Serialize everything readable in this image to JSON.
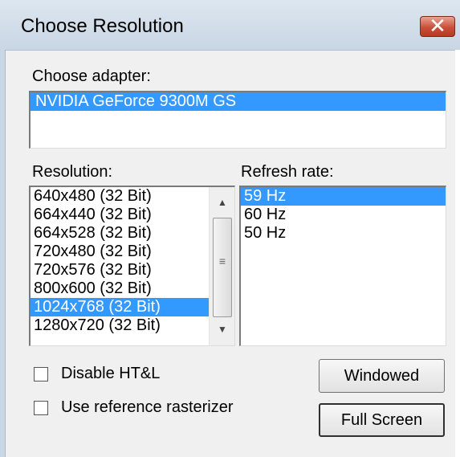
{
  "window": {
    "title": "Choose Resolution",
    "close_glyph": "✕"
  },
  "adapter": {
    "label": "Choose adapter:",
    "items": [
      {
        "label": "NVIDIA GeForce 9300M GS"
      }
    ],
    "selected": 0
  },
  "resolution": {
    "label": "Resolution:",
    "items": [
      {
        "label": "640x480 (32 Bit)"
      },
      {
        "label": "664x440 (32 Bit)"
      },
      {
        "label": "664x528 (32 Bit)"
      },
      {
        "label": "720x480 (32 Bit)"
      },
      {
        "label": "720x576 (32 Bit)"
      },
      {
        "label": "800x600 (32 Bit)"
      },
      {
        "label": "1024x768 (32 Bit)"
      },
      {
        "label": "1280x720 (32 Bit)"
      }
    ],
    "selected": 6,
    "scroll_up_glyph": "▲",
    "scroll_down_glyph": "▼",
    "scroll_grip_glyph": "≡"
  },
  "refresh": {
    "label": "Refresh rate:",
    "items": [
      {
        "label": "59 Hz"
      },
      {
        "label": "60 Hz"
      },
      {
        "label": "50 Hz"
      }
    ],
    "selected": 0
  },
  "options": {
    "disable_htl": {
      "label": "Disable HT&L",
      "checked": false
    },
    "reference_rasterizer": {
      "label": "Use reference rasterizer",
      "checked": false
    }
  },
  "buttons": {
    "windowed": "Windowed",
    "full_screen": "Full Screen"
  },
  "colors": {
    "selection": "#3399ff"
  }
}
